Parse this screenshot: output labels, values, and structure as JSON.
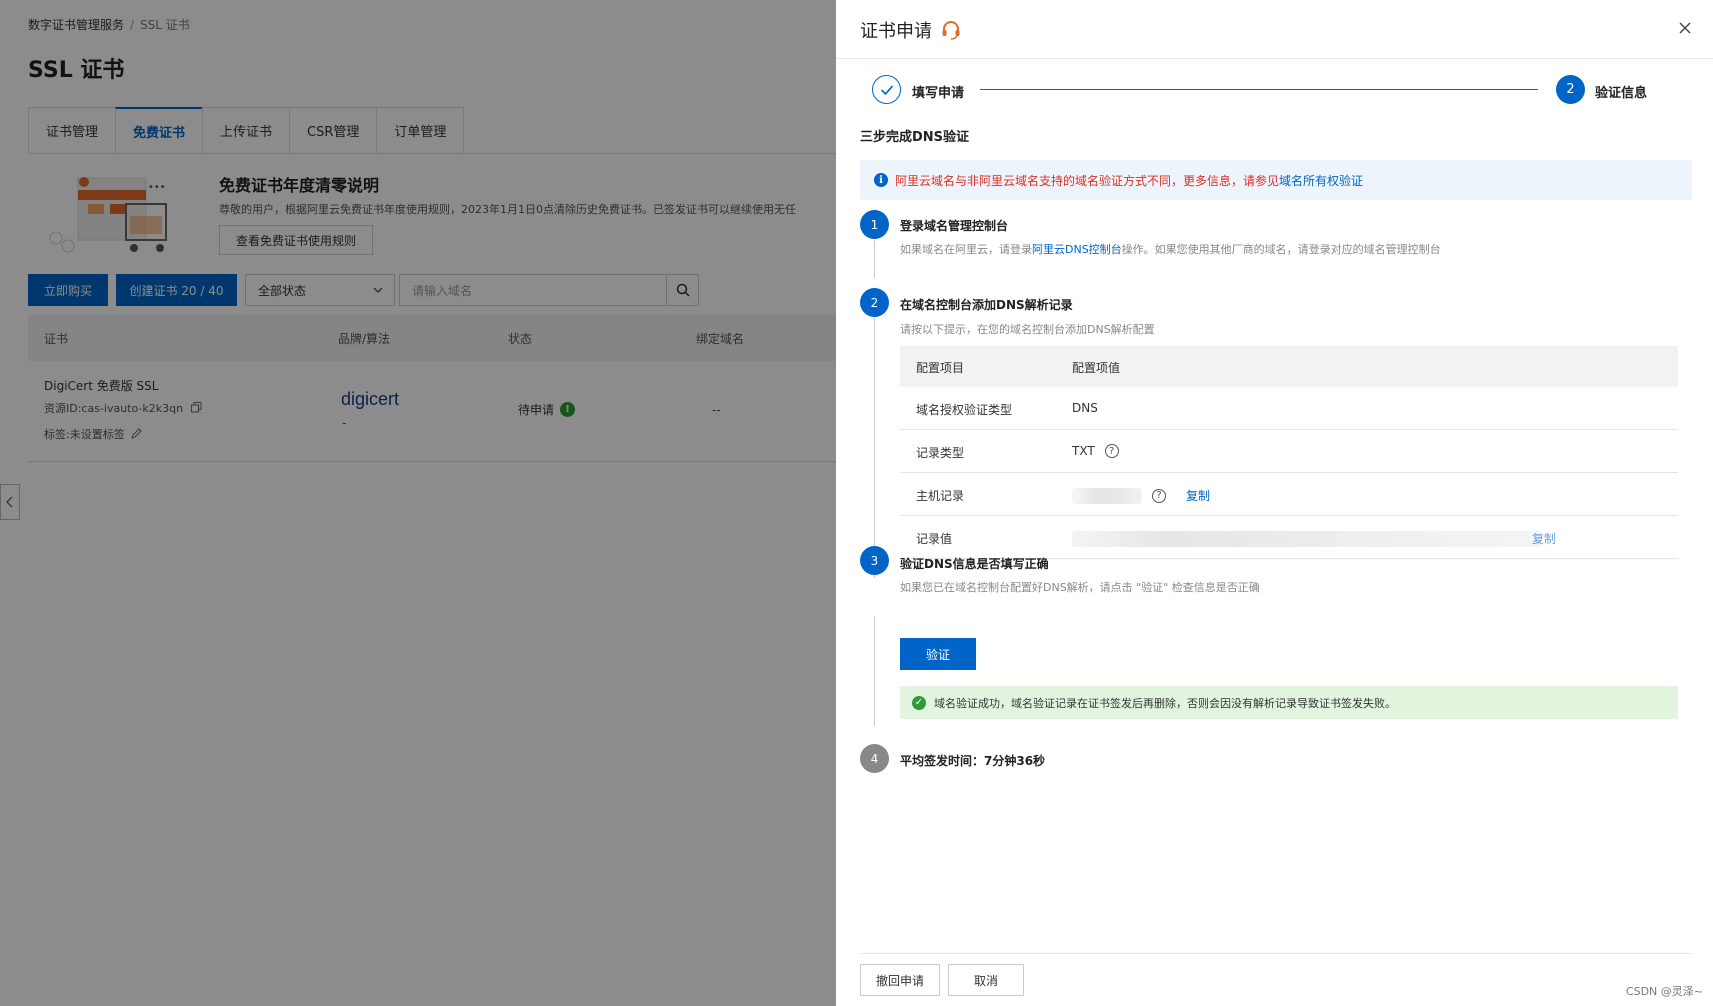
{
  "breadcrumb": {
    "parent": "数字证书管理服务",
    "separator": "/",
    "current": "SSL 证书"
  },
  "page_title": "SSL 证书",
  "tabs": [
    {
      "label": "证书管理"
    },
    {
      "label": "免费证书"
    },
    {
      "label": "上传证书"
    },
    {
      "label": "CSR管理"
    },
    {
      "label": "订单管理"
    }
  ],
  "notice": {
    "title": "免费证书年度清零说明",
    "text": "尊敬的用户，根据阿里云免费证书年度使用规则，2023年1月1日0点清除历史免费证书。已签发证书可以继续使用无任",
    "button": "查看免费证书使用规则"
  },
  "toolbar": {
    "buy_label": "立即购买",
    "create_label": "创建证书 20 / 40",
    "status_select": "全部状态",
    "search_placeholder": "请输入域名"
  },
  "table": {
    "headers": [
      "证书",
      "品牌/算法",
      "状态",
      "绑定域名"
    ],
    "row": {
      "name": "DigiCert 免费版 SSL",
      "resource_id": "资源ID:cas-ivauto-k2k3qn",
      "tag": "标签:未设置标签",
      "brand": "digicert",
      "algorithm": "-",
      "status": "待申请",
      "domain": "--"
    }
  },
  "drawer": {
    "title": "证书申请",
    "steps": [
      {
        "label": "填写申请",
        "state": "done"
      },
      {
        "number": "2",
        "label": "验证信息",
        "state": "current"
      }
    ],
    "section_title": "三步完成DNS验证",
    "alert": {
      "text": "阿里云域名与非阿里云域名支持的域名验证方式不同，更多信息，请参见",
      "link": "域名所有权验证"
    },
    "step1": {
      "number": "1",
      "title": "登录域名管理控制台",
      "desc_before": "如果域名在阿里云，请登录",
      "desc_link": "阿里云DNS控制台",
      "desc_after": "操作。如果您使用其他厂商的域名，请登录对应的域名管理控制台"
    },
    "step2": {
      "number": "2",
      "title": "在域名控制台添加DNS解析记录",
      "desc": "请按以下提示，在您的域名控制台添加DNS解析配置",
      "table": {
        "headers": [
          "配置项目",
          "配置项值"
        ],
        "rows": [
          {
            "label": "域名授权验证类型",
            "value": "DNS"
          },
          {
            "label": "记录类型",
            "value": "TXT"
          },
          {
            "label": "主机记录",
            "copy": "复制"
          },
          {
            "label": "记录值",
            "copy": "复制"
          }
        ]
      }
    },
    "step3": {
      "number": "3",
      "title": "验证DNS信息是否填写正确",
      "desc": "如果您已在域名控制台配置好DNS解析，请点击 \"验证\" 检查信息是否正确",
      "button": "验证",
      "success": "域名验证成功，域名验证记录在证书签发后再删除，否则会因没有解析记录导致证书签发失败。"
    },
    "step4": {
      "number": "4",
      "title": "平均签发时间：7分钟36秒"
    },
    "footer": {
      "revoke_label": "撤回申请",
      "cancel_label": "取消"
    }
  },
  "watermark": "CSDN @灵泽~",
  "colors": {
    "primary": "#0064c8",
    "danger": "#d93026",
    "success": "#2e9b3a",
    "overlay": "rgba(0,0,0,0.45)"
  }
}
